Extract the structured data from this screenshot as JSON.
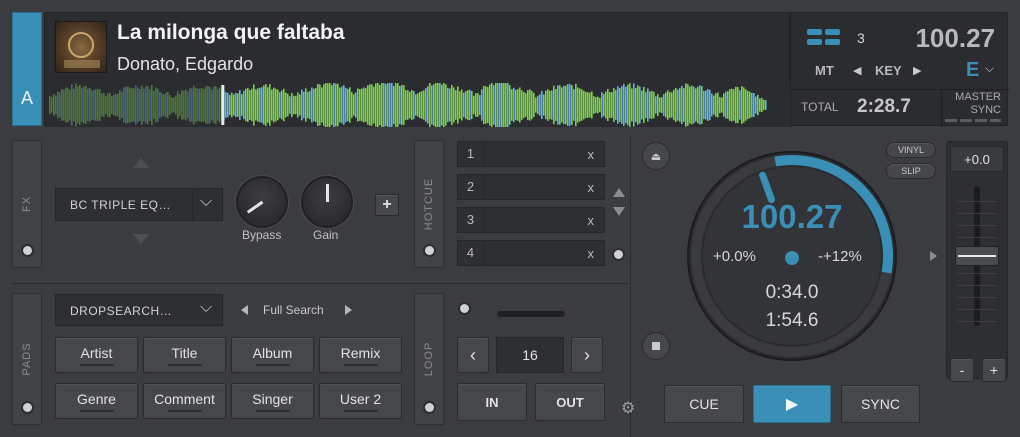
{
  "deck": {
    "letter": "A",
    "track_title": "La milonga que faltaba",
    "track_artist": "Donato, Edgardo",
    "deck_number": "3",
    "bpm": "100.27",
    "mt_label": "MT",
    "key_label": "KEY",
    "key_value": "E",
    "total_label": "TOTAL",
    "total_time": "2:28.7",
    "master_label": "MASTER",
    "sync_label": "SYNC",
    "playhead_fraction": 0.24
  },
  "fx": {
    "sidebar_label": "FX",
    "effect_name": "BC TRIPLE EQ…",
    "bypass_label": "Bypass",
    "gain_label": "Gain",
    "add_label": "+"
  },
  "hotcue": {
    "sidebar_label": "HOTCUE",
    "slots": [
      {
        "num": "1",
        "clear": "x"
      },
      {
        "num": "2",
        "clear": "x"
      },
      {
        "num": "3",
        "clear": "x"
      },
      {
        "num": "4",
        "clear": "x"
      }
    ]
  },
  "pads": {
    "sidebar_label": "PADS",
    "dropdown": "DROPSEARCH…",
    "mode": "Full Search",
    "buttons": [
      "Artist",
      "Title",
      "Album",
      "Remix",
      "Genre",
      "Comment",
      "Singer",
      "User 2"
    ]
  },
  "loop": {
    "sidebar_label": "LOOP",
    "size": "16",
    "in_label": "IN",
    "out_label": "OUT"
  },
  "jog": {
    "bpm": "100.27",
    "pitch": "+0.0%",
    "range": "-+12%",
    "elapsed": "0:34.0",
    "remaining": "1:54.6",
    "vinyl_label": "VINYL",
    "slip_label": "SLIP"
  },
  "transport": {
    "cue_label": "CUE",
    "play_label": "▶",
    "sync_label": "SYNC"
  },
  "pitch_slider": {
    "value": "+0.0",
    "minus": "-",
    "plus": "+"
  },
  "colors": {
    "accent": "#3a8fb7",
    "waveform_green": "#7bd34a",
    "waveform_blue": "#5fb8e0"
  }
}
